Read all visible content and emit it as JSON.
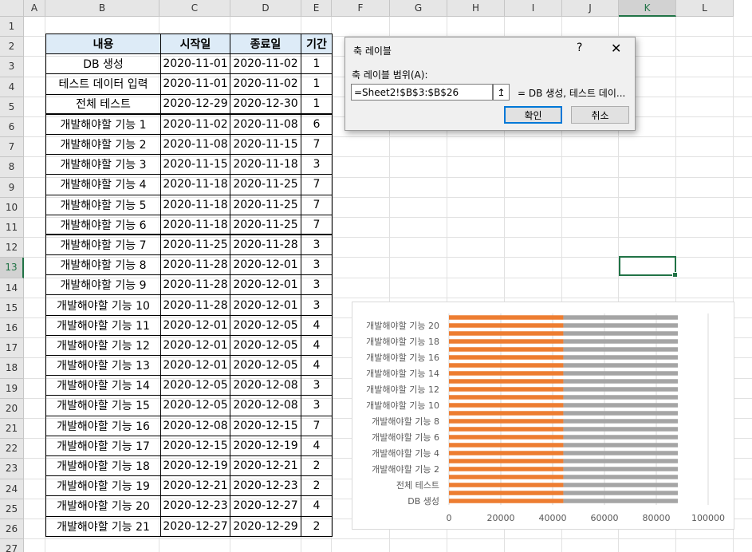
{
  "columns": [
    "A",
    "B",
    "C",
    "D",
    "E",
    "F",
    "G",
    "H",
    "I",
    "J",
    "K",
    "L"
  ],
  "selected_column": "K",
  "rows": [
    "1",
    "2",
    "3",
    "4",
    "5",
    "6",
    "7",
    "8",
    "9",
    "10",
    "11",
    "12",
    "13",
    "14",
    "15",
    "16",
    "17",
    "18",
    "19",
    "20",
    "21",
    "22",
    "23",
    "24",
    "25",
    "26",
    "27"
  ],
  "selected_row": "13",
  "table": {
    "headers": [
      "내용",
      "시작일",
      "종료일",
      "기간"
    ],
    "rows": [
      [
        "DB 생성",
        "2020-11-01",
        "2020-11-02",
        "1"
      ],
      [
        "테스트 데이터 입력",
        "2020-11-01",
        "2020-11-02",
        "1"
      ],
      [
        "전체 테스트",
        "2020-12-29",
        "2020-12-30",
        "1"
      ],
      [
        "개발해야할 기능 1",
        "2020-11-02",
        "2020-11-08",
        "6"
      ],
      [
        "개발해야할 기능 2",
        "2020-11-08",
        "2020-11-15",
        "7"
      ],
      [
        "개발해야할 기능 3",
        "2020-11-15",
        "2020-11-18",
        "3"
      ],
      [
        "개발해야할 기능 4",
        "2020-11-18",
        "2020-11-25",
        "7"
      ],
      [
        "개발해야할 기능 5",
        "2020-11-18",
        "2020-11-25",
        "7"
      ],
      [
        "개발해야할 기능 6",
        "2020-11-18",
        "2020-11-25",
        "7"
      ],
      [
        "개발해야할 기능 7",
        "2020-11-25",
        "2020-11-28",
        "3"
      ],
      [
        "개발해야할 기능 8",
        "2020-11-28",
        "2020-12-01",
        "3"
      ],
      [
        "개발해야할 기능 9",
        "2020-11-28",
        "2020-12-01",
        "3"
      ],
      [
        "개발해야할 기능 10",
        "2020-11-28",
        "2020-12-01",
        "3"
      ],
      [
        "개발해야할 기능 11",
        "2020-12-01",
        "2020-12-05",
        "4"
      ],
      [
        "개발해야할 기능 12",
        "2020-12-01",
        "2020-12-05",
        "4"
      ],
      [
        "개발해야할 기능 13",
        "2020-12-01",
        "2020-12-05",
        "4"
      ],
      [
        "개발해야할 기능 14",
        "2020-12-05",
        "2020-12-08",
        "3"
      ],
      [
        "개발해야할 기능 15",
        "2020-12-05",
        "2020-12-08",
        "3"
      ],
      [
        "개발해야할 기능 16",
        "2020-12-08",
        "2020-12-15",
        "7"
      ],
      [
        "개발해야할 기능 17",
        "2020-12-15",
        "2020-12-19",
        "4"
      ],
      [
        "개발해야할 기능 18",
        "2020-12-19",
        "2020-12-21",
        "2"
      ],
      [
        "개발해야할 기능 19",
        "2020-12-21",
        "2020-12-23",
        "2"
      ],
      [
        "개발해야할 기능 20",
        "2020-12-23",
        "2020-12-27",
        "4"
      ],
      [
        "개발해야할 기능 21",
        "2020-12-27",
        "2020-12-29",
        "2"
      ]
    ]
  },
  "dialog": {
    "title": "축 레이블",
    "help": "?",
    "close": "✕",
    "range_label": "축 레이블 범위(A):",
    "range_value": "=Sheet2!$B$3:$B$26",
    "collapse_icon": "↥",
    "preview": "= DB 생성, 테스트  데이...",
    "ok_label": "확인",
    "cancel_label": "취소"
  },
  "chart_data": {
    "type": "bar",
    "orientation": "horizontal",
    "stacked": true,
    "category_labels": [
      "DB 생성",
      "전체 테스트",
      "개발해야할 기능 2",
      "개발해야할 기능 4",
      "개발해야할 기능 6",
      "개발해야할 기능 8",
      "개발해야할 기능 10",
      "개발해야할 기능 12",
      "개발해야할 기능 14",
      "개발해야할 기능 16",
      "개발해야할 기능 18",
      "개발해야할 기능 20"
    ],
    "bar_count": 24,
    "series": [
      {
        "color": "#ed7d31",
        "value": 44136
      },
      {
        "color": "#a5a5a5",
        "value": 44165
      }
    ],
    "xlim": [
      0,
      100000
    ],
    "xticks": [
      "0",
      "20000",
      "40000",
      "60000",
      "80000",
      "100000"
    ],
    "grid": true
  }
}
